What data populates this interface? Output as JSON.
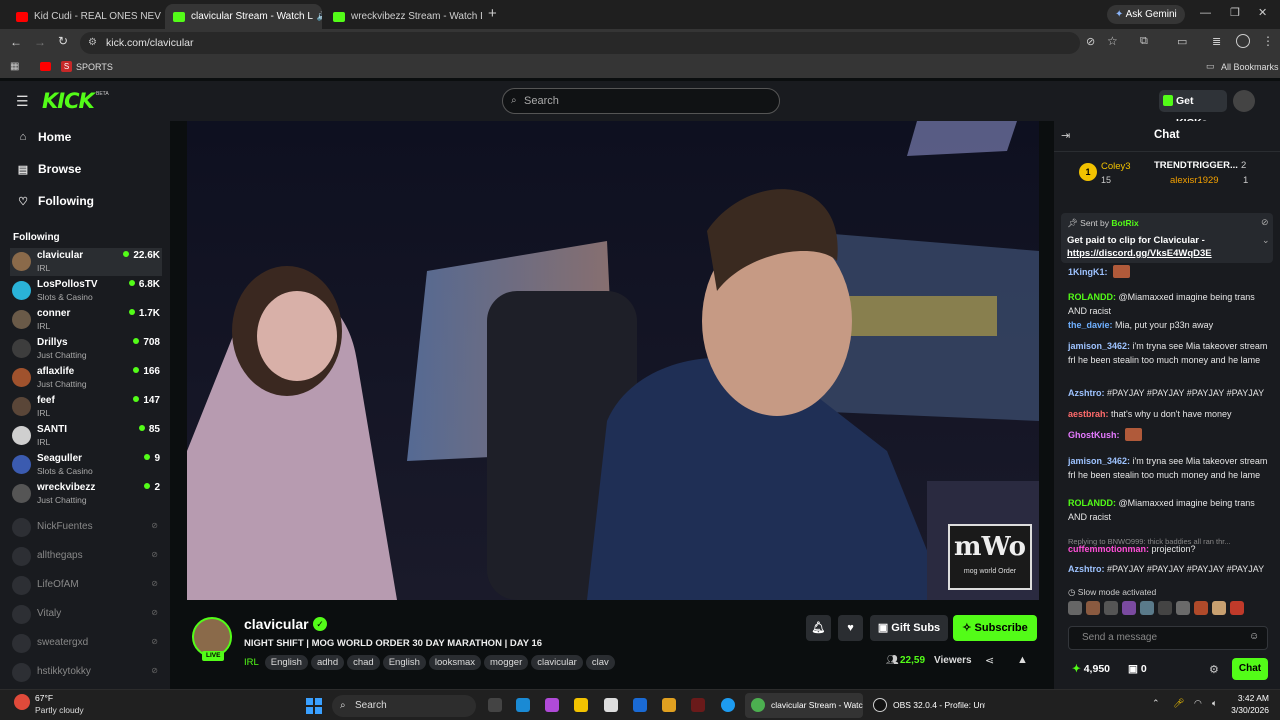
{
  "browser": {
    "tabs": [
      {
        "label": "Kid Cudi - REAL ONES NEV",
        "color": "#ff0000"
      },
      {
        "label": "clavicular Stream - Watch L",
        "color": "#53fc18"
      },
      {
        "label": "wreckvibezz Stream - Watch Liv",
        "color": "#53fc18"
      }
    ],
    "url": "kick.com/clavicular",
    "gemini": "Ask Gemini",
    "bookmarks": {
      "sports": "SPORTS",
      "all": "All Bookmarks"
    }
  },
  "kick": {
    "logo": "KICK",
    "beta": "BETA",
    "search_placeholder": "Search",
    "get_kicks": "Get KICKs"
  },
  "sidebar": {
    "nav": [
      {
        "label": "Home",
        "icon": "home-icon"
      },
      {
        "label": "Browse",
        "icon": "browse-icon"
      },
      {
        "label": "Following",
        "icon": "heart-icon"
      }
    ],
    "following_header": "Following",
    "live": [
      {
        "name": "clavicular",
        "category": "IRL",
        "viewers": "22.6K",
        "color": "#8a6a4a"
      },
      {
        "name": "LosPollosTV",
        "category": "Slots & Casino",
        "viewers": "6.8K",
        "color": "#2ab3d8"
      },
      {
        "name": "conner",
        "category": "IRL",
        "viewers": "1.7K",
        "color": "#6a5a48"
      },
      {
        "name": "Drillys",
        "category": "Just Chatting",
        "viewers": "708",
        "color": "#3d3d3d"
      },
      {
        "name": "aflaxlife",
        "category": "Just Chatting",
        "viewers": "166",
        "color": "#a0522d"
      },
      {
        "name": "feef",
        "category": "IRL",
        "viewers": "147",
        "color": "#5a4638"
      },
      {
        "name": "SANTI",
        "category": "IRL",
        "viewers": "85",
        "color": "#cfcfcf"
      },
      {
        "name": "Seaguller",
        "category": "Slots & Casino",
        "viewers": "9",
        "color": "#3b5bb0"
      },
      {
        "name": "wreckvibezz",
        "category": "Just Chatting",
        "viewers": "2",
        "color": "#555"
      }
    ],
    "offline": [
      "NickFuentes",
      "allthegaps",
      "LifeOfAM",
      "Vitaly",
      "sweatergxd",
      "hstikkytokky"
    ]
  },
  "stream": {
    "streamer": "clavicular",
    "live_badge": "LIVE",
    "title": "NIGHT SHIFT | MOG WORLD ORDER 30 DAY MARATHON | DAY 16",
    "category": "IRL",
    "tags": [
      "English",
      "adhd",
      "chad",
      "English",
      "looksmax",
      "mogger",
      "clavicular",
      "clav"
    ],
    "viewers": "22,59",
    "viewers_label": "Viewers",
    "gift_subs": "Gift Subs",
    "subscribe": "Subscribe",
    "watermark_logo": "mWo",
    "watermark_sub": "mog world Order"
  },
  "chat": {
    "header": "Chat",
    "leaderboard": [
      {
        "rank": "1",
        "name": "Coley3",
        "count": "15"
      },
      {
        "name": "TRENDTRIGGER...",
        "count": "2"
      },
      {
        "name": "alexisr1929",
        "count": "1"
      }
    ],
    "pinned": {
      "sent_by": "Sent by",
      "bot": "BotRix",
      "text": "Get paid to clip for Clavicular -",
      "link": "https://discord.gg/VksE4WqD3E"
    },
    "messages": [
      {
        "user": "1KingK1:",
        "text": "",
        "color": "#9ec3ff"
      },
      {
        "user": "ROLANDD:",
        "text": "@Miamaxxed imagine being trans AND racist",
        "color": "#53fc18"
      },
      {
        "user": "the_davie:",
        "text": "Mia, put your p33n away",
        "color": "#6fb0ff"
      },
      {
        "user": "jamison_3462:",
        "text": "i'm tryna see Mia takeover stream frl he been stealin too much money and he lame",
        "color": "#9ec3ff"
      },
      {
        "user": "Azshtro:",
        "text": "#PAYJAY #PAYJAY #PAYJAY #PAYJAY",
        "color": "#9ec3ff"
      },
      {
        "user": "aestbrah:",
        "text": "that's why u don't have money",
        "color": "#ff6b6b"
      },
      {
        "user": "GhostKush:",
        "text": "",
        "color": "#e57aff"
      },
      {
        "user": "jamison_3462:",
        "text": "i'm tryna see Mia takeover stream frl he been stealin too much money and he lame",
        "color": "#9ec3ff"
      },
      {
        "user": "ROLANDD:",
        "text": "@Miamaxxed imagine being trans AND racist",
        "color": "#53fc18"
      },
      {
        "user": "cuffemmotionman:",
        "text": "projection?",
        "color": "#ff4fd8"
      },
      {
        "user": "Azshtro:",
        "text": "#PAYJAY #PAYJAY #PAYJAY #PAYJAY",
        "color": "#9ec3ff"
      }
    ],
    "reply_note": "Replying to BNWO999: thick baddies all ran thr...",
    "slow_mode": "Slow mode activated",
    "send_placeholder": "Send a message",
    "points": "4,950",
    "gift_count": "0",
    "chat_button": "Chat"
  },
  "taskbar": {
    "weather_temp": "67°F",
    "weather_desc": "Partly cloudy",
    "search": "Search",
    "app1": "clavicular Stream - Watc",
    "app2": "OBS 32.0.4 - Profile: Unt",
    "time": "3:42 AM",
    "date": "3/30/2026"
  }
}
